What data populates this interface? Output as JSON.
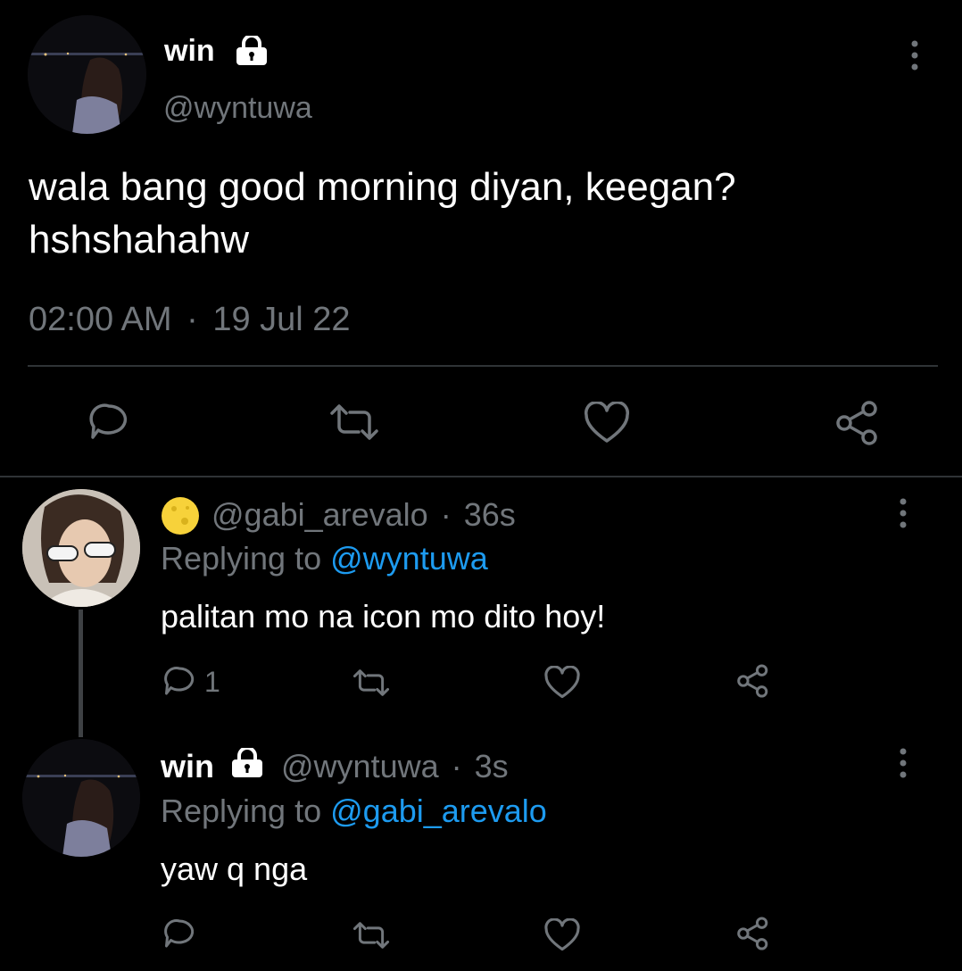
{
  "main_tweet": {
    "display_name": "win",
    "handle": "@wyntuwa",
    "text_line1": "wala bang good morning diyan, keegan?",
    "text_line2": "hshshahahw",
    "time": "02:00 AM",
    "separator": "·",
    "date": "19 Jul 22"
  },
  "replies": [
    {
      "handle": "@gabi_arevalo",
      "separator": "·",
      "time": "36s",
      "replying_prefix": "Replying to",
      "replying_to": "@wyntuwa",
      "text": "palitan mo na icon mo dito hoy!",
      "reply_count": "1"
    },
    {
      "display_name": "win",
      "handle": "@wyntuwa",
      "separator": "·",
      "time": "3s",
      "replying_prefix": "Replying to",
      "replying_to": "@gabi_arevalo",
      "text": "yaw q nga",
      "reply_count": ""
    }
  ],
  "colors": {
    "background": "#000000",
    "muted": "#71767b",
    "link": "#1d9bf0",
    "divider": "#2f3336"
  },
  "icons": [
    "lock-icon",
    "more-icon",
    "reply-icon",
    "retweet-icon",
    "like-icon",
    "share-icon",
    "moon-emoji-icon"
  ]
}
